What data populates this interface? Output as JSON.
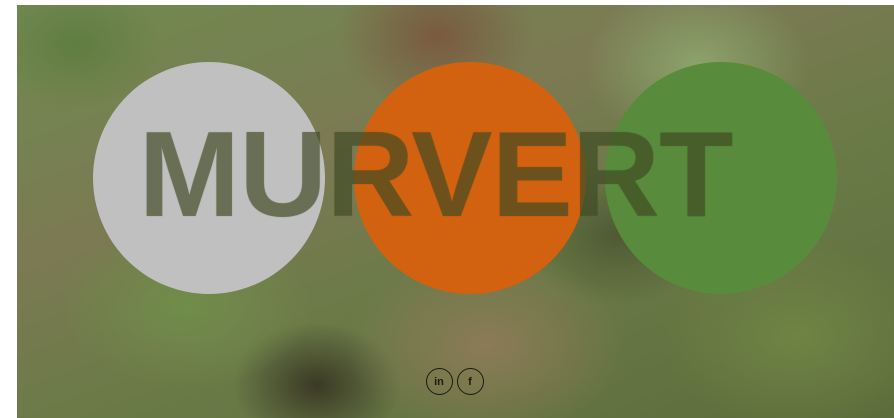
{
  "brand": {
    "logo_text": "MURVERT",
    "circle_colors": [
      "#c0c0c0",
      "#d2620f",
      "#588c3c"
    ]
  },
  "social": [
    {
      "label": "in",
      "icon": "linkedin-icon"
    },
    {
      "label": "f",
      "icon": "facebook-icon"
    }
  ]
}
